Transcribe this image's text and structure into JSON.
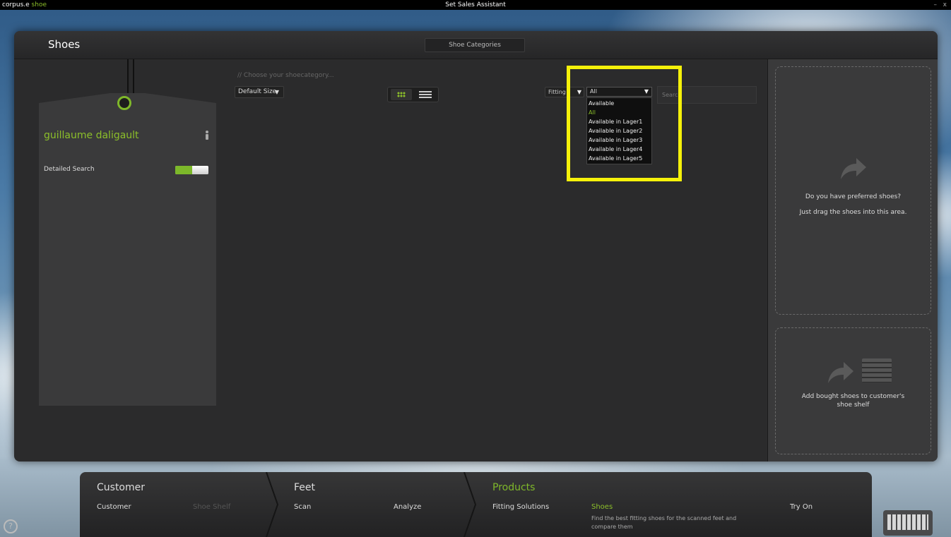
{
  "titlebar": {
    "logo_main": "corpus.e",
    "logo_shoe": "shoe",
    "title": "Set Sales Assistant",
    "minimize": "–",
    "close": "x"
  },
  "header": {
    "title": "Shoes",
    "categories_button": "Shoe Categories"
  },
  "customer_card": {
    "name": "guillaume daligault",
    "detailed_search_label": "Detailed Search",
    "detailed_search_on": true
  },
  "toolbar": {
    "hint": "// Choose your shoecategory...",
    "size_dropdown": "Default Size",
    "fitting_dropdown": "Fitting",
    "availability_selected": "All",
    "search_placeholder": "Search",
    "availability_options": [
      "Available",
      "All",
      "Available in Lager1",
      "Available in Lager2",
      "Available in Lager3",
      "Available in Lager4",
      "Available in Lager5"
    ]
  },
  "dropzones": {
    "preferred_line1": "Do you have preferred shoes?",
    "preferred_line2": "Just drag the shoes into this area.",
    "shelf_line1": "Add bought shoes to customer's",
    "shelf_line2": "shoe shelf"
  },
  "bottom_nav": {
    "sections": [
      {
        "title": "Customer",
        "items": [
          "Customer",
          "Shoe Shelf"
        ]
      },
      {
        "title": "Feet",
        "items": [
          "Scan",
          "Analyze"
        ]
      },
      {
        "title": "Products",
        "items": [
          "Fitting Solutions",
          "Shoes",
          "Try On"
        ]
      }
    ],
    "shoes_desc": "Find the best fitting shoes for the scanned feet and compare them"
  },
  "colors": {
    "accent": "#8cbf2a",
    "highlight": "#f5f10a",
    "panel": "#2b2b2c"
  },
  "icons": [
    "person-icon",
    "grid-view-icon",
    "list-view-icon",
    "drag-arrow-icon",
    "shelf-icon",
    "keyboard-icon",
    "help-icon"
  ]
}
